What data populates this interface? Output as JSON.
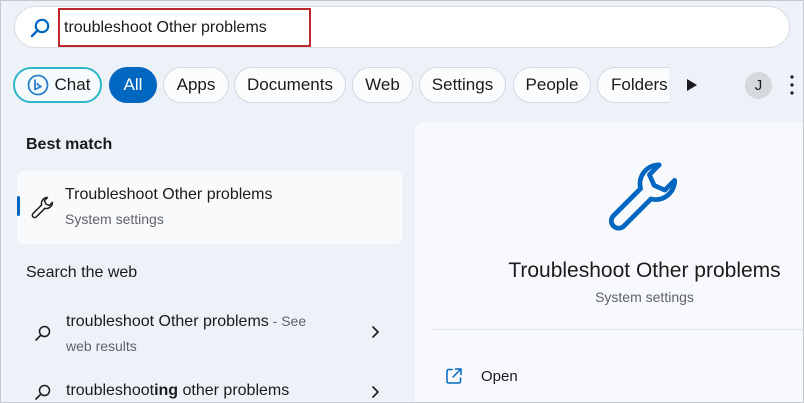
{
  "search": {
    "query": "troubleshoot Other problems"
  },
  "filters": {
    "chat": "Chat",
    "all": "All",
    "apps": "Apps",
    "documents": "Documents",
    "web": "Web",
    "settings": "Settings",
    "people": "People",
    "folders": "Folders",
    "active": "All"
  },
  "account": {
    "initial": "J"
  },
  "best_match": {
    "heading": "Best match",
    "title": "Troubleshoot Other problems",
    "subtitle": "System settings",
    "icon": "wrench-icon"
  },
  "web_search": {
    "heading": "Search the web",
    "results": [
      {
        "query": "troubleshoot Other problems",
        "suffix": " - See",
        "suffix_line2": "web results"
      },
      {
        "query_prefix": "troubleshoot",
        "query_bold": "ing",
        "query_rest": " other problems"
      }
    ]
  },
  "preview": {
    "title": "Troubleshoot Other problems",
    "subtitle": "System settings",
    "actions": [
      {
        "label": "Open",
        "icon": "open-external-icon"
      }
    ]
  },
  "colors": {
    "accent": "#0067c0",
    "chat_border": "#2fb5c8",
    "highlight_box": "#c0272d",
    "background": "#edf2f9"
  }
}
